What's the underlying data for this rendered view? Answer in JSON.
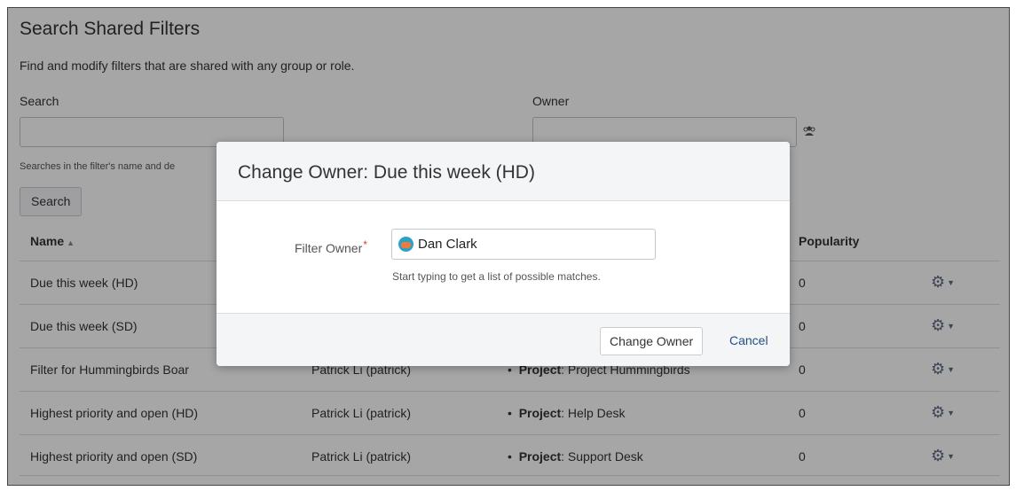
{
  "page": {
    "title": "Search Shared Filters",
    "description": "Find and modify filters that are shared with any group or role.",
    "search_label": "Search",
    "owner_label": "Owner",
    "search_hint": "Searches in the filter's name and de",
    "search_button": "Search",
    "owner_icon": "user-picker-icon"
  },
  "table": {
    "headers": {
      "name": "Name",
      "popularity": "Popularity"
    },
    "rows": [
      {
        "name": "Due this week (HD)",
        "owner": "",
        "shared_prefix": "",
        "shared_value": "",
        "popularity": "0"
      },
      {
        "name": "Due this week (SD)",
        "owner": "",
        "shared_prefix": "",
        "shared_value": "",
        "popularity": "0"
      },
      {
        "name": "Filter for Hummingbirds Boar",
        "owner": "Patrick Li (patrick)",
        "shared_prefix": "Project",
        "shared_value": ": Project Hummingbirds",
        "popularity": "0"
      },
      {
        "name": "Highest priority and open (HD)",
        "owner": "Patrick Li (patrick)",
        "shared_prefix": "Project",
        "shared_value": ": Help Desk",
        "popularity": "0"
      },
      {
        "name": "Highest priority and open (SD)",
        "owner": "Patrick Li (patrick)",
        "shared_prefix": "Project",
        "shared_value": ": Support Desk",
        "popularity": "0"
      }
    ]
  },
  "dialog": {
    "title": "Change Owner: Due this week (HD)",
    "field_label": "Filter Owner",
    "required_mark": "*",
    "owner_value": "Dan Clark",
    "hint": "Start typing to get a list of possible matches.",
    "submit_label": "Change Owner",
    "cancel_label": "Cancel"
  },
  "colors": {
    "link": "#205081",
    "required": "#d04437",
    "overlay": "rgba(0,0,0,0.35)"
  }
}
